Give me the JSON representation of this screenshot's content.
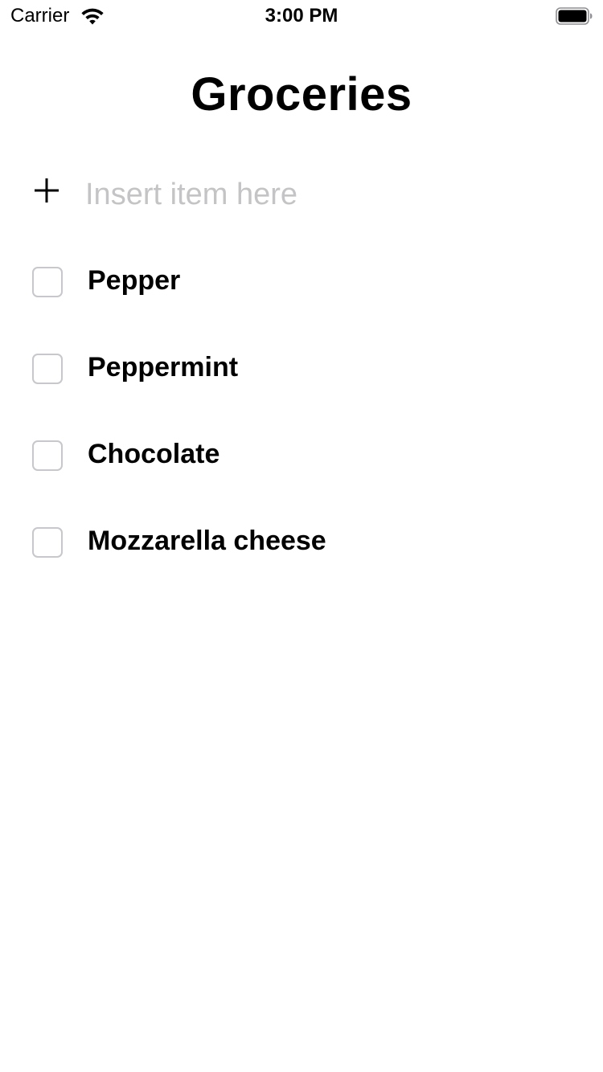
{
  "status_bar": {
    "carrier": "Carrier",
    "time": "3:00 PM",
    "wifi_icon": "wifi-icon",
    "battery_icon": "battery-full-icon"
  },
  "title": "Groceries",
  "add_item": {
    "icon": "plus-icon",
    "placeholder": "Insert item here",
    "value": ""
  },
  "items": [
    {
      "label": "Pepper",
      "checked": false
    },
    {
      "label": "Peppermint",
      "checked": false
    },
    {
      "label": "Chocolate",
      "checked": false
    },
    {
      "label": "Mozzarella cheese",
      "checked": false
    }
  ],
  "colors": {
    "text": "#000000",
    "placeholder": "#c4c4c6",
    "checkbox_border": "#c7c7cc",
    "background": "#ffffff"
  }
}
